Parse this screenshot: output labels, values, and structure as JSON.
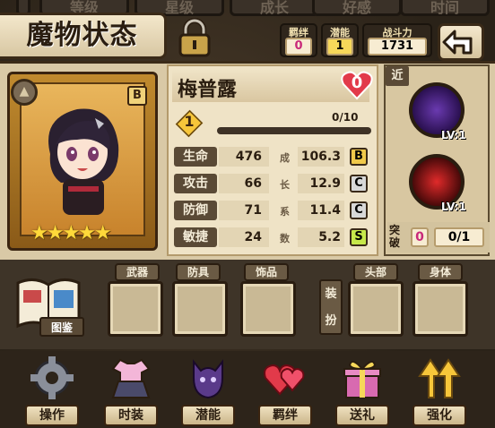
{
  "top_tabs": [
    "等级",
    "星级",
    "成长",
    "好感",
    "时间"
  ],
  "title": "魔物状态",
  "stats_header": {
    "bond_label": "羁绊",
    "bond_value": "0",
    "potential_label": "潜能",
    "potential_value": "1",
    "power_label": "战斗力",
    "power_value": "1731"
  },
  "character": {
    "name": "梅普露",
    "rank": "B",
    "element_icon": "mountain-icon",
    "stars": "★★★★★",
    "heart_value": "0",
    "level": "1",
    "xp": "0/10"
  },
  "attributes": [
    {
      "label": "生命",
      "value": "476",
      "growth_char": "成",
      "growth": "106.3",
      "grade": "B",
      "grade_color": "#f0c94a"
    },
    {
      "label": "攻击",
      "value": "66",
      "growth_char": "长",
      "growth": "12.9",
      "grade": "C",
      "grade_color": "#d8d8d8"
    },
    {
      "label": "防御",
      "value": "71",
      "growth_char": "系",
      "growth": "11.4",
      "grade": "C",
      "grade_color": "#d8d8d8"
    },
    {
      "label": "敏捷",
      "value": "24",
      "growth_char": "数",
      "growth": "5.2",
      "grade": "S",
      "grade_color": "#c6e84a"
    }
  ],
  "skills": {
    "tag": "近",
    "skill1_lv": "LV:1",
    "skill2_lv": "LV:1"
  },
  "breakthrough": {
    "label": "突破",
    "count": "0",
    "progress": "0/1"
  },
  "equipment": {
    "book_label": "图鉴",
    "slots": [
      "武器",
      "防具",
      "饰品",
      "头部",
      "身体"
    ],
    "side_label": "装扮"
  },
  "toolbar": [
    {
      "label": "操作",
      "icon": "gear-icon"
    },
    {
      "label": "时装",
      "icon": "outfit-icon"
    },
    {
      "label": "潜能",
      "icon": "shadow-icon"
    },
    {
      "label": "羁绊",
      "icon": "hearts-icon"
    },
    {
      "label": "送礼",
      "icon": "gift-icon"
    },
    {
      "label": "强化",
      "icon": "upgrade-arrows-icon"
    }
  ]
}
